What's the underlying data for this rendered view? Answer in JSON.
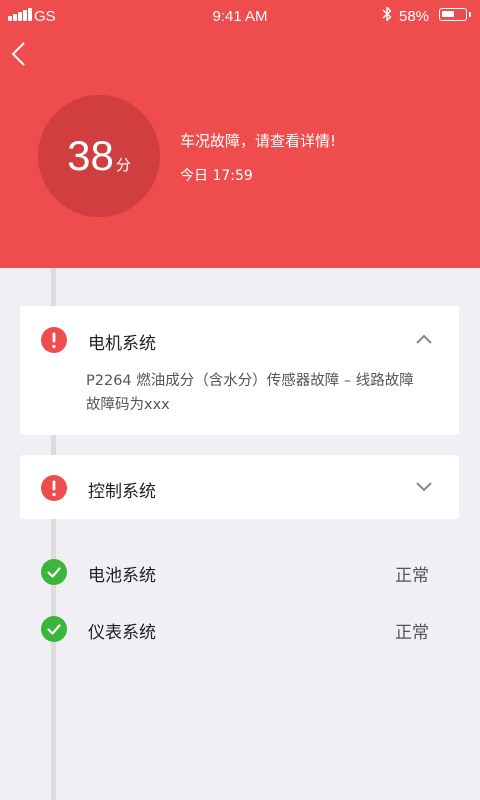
{
  "status_bar": {
    "carrier": "GS",
    "time": "9:41 AM",
    "battery_percent_label": "58%",
    "battery_level": 0.58
  },
  "header": {
    "score": "38",
    "score_unit": "分",
    "alert_text": "车况故障，请查看详情!",
    "date_text": "今日 17:59"
  },
  "systems": [
    {
      "name": "电机系统",
      "state": "fault",
      "expanded": true,
      "details": [
        "P2264  燃油成分（含水分）传感器故障 – 线路故障",
        "故障码为xxx"
      ]
    },
    {
      "name": "控制系统",
      "state": "fault",
      "expanded": false
    },
    {
      "name": "电池系统",
      "state": "ok",
      "status_label": "正常"
    },
    {
      "name": "仪表系统",
      "state": "ok",
      "status_label": "正常"
    }
  ],
  "colors": {
    "header_bg": "#ef4c4d",
    "score_circle": "#d03e40",
    "fault": "#ef4c4d",
    "ok": "#3bb53a",
    "page_bg": "#f0f0f4"
  }
}
